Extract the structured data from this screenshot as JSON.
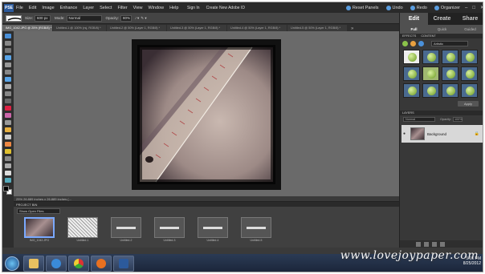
{
  "menu": {
    "app_logo": "PSE",
    "items": [
      "File",
      "Edit",
      "Image",
      "Enhance",
      "Layer",
      "Select",
      "Filter",
      "View",
      "Window",
      "Help"
    ],
    "signin": "Sign In",
    "create_id": "Create New Adobe ID",
    "reset_panels": "Reset Panels",
    "undo": "Undo",
    "redo": "Redo",
    "organizer": "Organizer"
  },
  "options": {
    "size_label": "Size:",
    "size_value": "600 px",
    "mode_label": "Mode:",
    "mode_value": "Normal",
    "opacity_label": "Opacity:",
    "opacity_value": "80%"
  },
  "tabs": [
    "IMG_1042.JPG @ 25% (RGB/8) *",
    "Untitled-1 @ 100% (rsj, RGB/8) *",
    "Untitled-2 @ 50% (Layer 1, RGB/8) *",
    "Untitled-3 @ 50% (Layer 1, RGB/8) *",
    "Untitled-4 @ 50% (Layer 1, RGB/8) *",
    "Untitled-5 @ 50% (Layer 1, RGB/8) *"
  ],
  "status": "25%    26.889 inches x 26.889 inches (...",
  "project_bin": {
    "header": "PROJECT BIN",
    "select": "Show Open Files",
    "thumbs": [
      "IMG_1042.JPG",
      "Untitled-1",
      "Untitled-2",
      "Untitled-3",
      "Untitled-4",
      "Untitled-5"
    ]
  },
  "panel": {
    "modes": [
      "Edit",
      "Create",
      "Share"
    ],
    "subtabs": [
      "Full",
      "Quick",
      "Guided"
    ],
    "effects_header": "EFFECTS",
    "content_header": "CONTENT",
    "effects_select": "Artistic",
    "apply": "Apply",
    "layers_header": "LAYERS",
    "blend": "Normal",
    "opacity_label": "Opacity:",
    "opacity_value": "100%",
    "layer_name": "Background"
  },
  "taskbar": {
    "time": "5:05 PM",
    "date": "8/25/2012"
  },
  "watermark": "www.lovejoypaper.com",
  "colors": {
    "accent": "#5a9de0",
    "canvas_bg": "#6a6a6a",
    "panel_bg": "#383838"
  }
}
